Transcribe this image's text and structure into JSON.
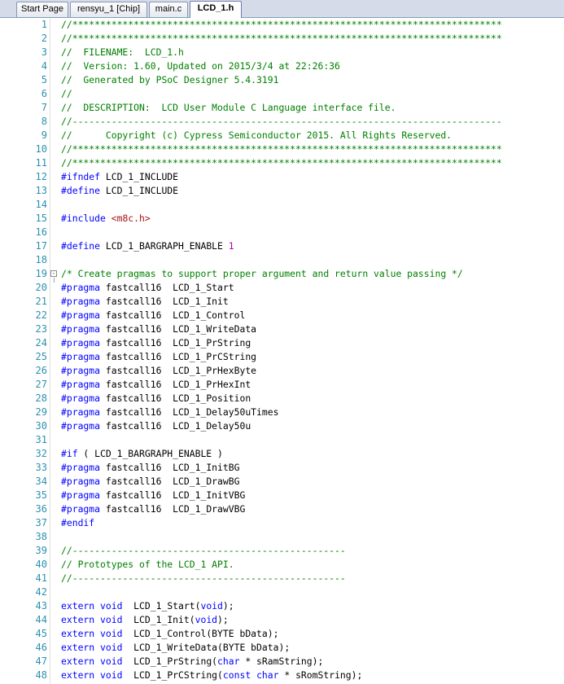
{
  "tabs": [
    {
      "label": "Start Page",
      "active": false
    },
    {
      "label": "rensyu_1 [Chip]",
      "active": false
    },
    {
      "label": "main.c",
      "active": false
    },
    {
      "label": "LCD_1.h",
      "active": true
    }
  ],
  "colors": {
    "comment": "#008000",
    "keyword": "#0000ff",
    "string": "#a31515",
    "number": "#b000b0",
    "line_number": "#2b91af"
  },
  "lines": [
    {
      "n": "1",
      "tokens": [
        {
          "t": "c",
          "v": "//*****************************************************************************"
        }
      ]
    },
    {
      "n": "2",
      "tokens": [
        {
          "t": "c",
          "v": "//*****************************************************************************"
        }
      ]
    },
    {
      "n": "3",
      "tokens": [
        {
          "t": "c",
          "v": "//  FILENAME:  LCD_1.h"
        }
      ]
    },
    {
      "n": "4",
      "tokens": [
        {
          "t": "c",
          "v": "//  Version: 1.60, Updated on 2015/3/4 at 22:26:36"
        }
      ]
    },
    {
      "n": "5",
      "tokens": [
        {
          "t": "c",
          "v": "//  Generated by PSoC Designer 5.4.3191"
        }
      ]
    },
    {
      "n": "6",
      "tokens": [
        {
          "t": "c",
          "v": "//"
        }
      ]
    },
    {
      "n": "7",
      "tokens": [
        {
          "t": "c",
          "v": "//  DESCRIPTION:  LCD User Module C Language interface file."
        }
      ]
    },
    {
      "n": "8",
      "tokens": [
        {
          "t": "c",
          "v": "//-----------------------------------------------------------------------------"
        }
      ]
    },
    {
      "n": "9",
      "tokens": [
        {
          "t": "c",
          "v": "//      Copyright (c) Cypress Semiconductor 2015. All Rights Reserved."
        }
      ]
    },
    {
      "n": "10",
      "tokens": [
        {
          "t": "c",
          "v": "//*****************************************************************************"
        }
      ]
    },
    {
      "n": "11",
      "tokens": [
        {
          "t": "c",
          "v": "//*****************************************************************************"
        }
      ]
    },
    {
      "n": "12",
      "tokens": [
        {
          "t": "k",
          "v": "#ifndef"
        },
        {
          "t": "p",
          "v": " LCD_1_INCLUDE"
        }
      ]
    },
    {
      "n": "13",
      "tokens": [
        {
          "t": "k",
          "v": "#define"
        },
        {
          "t": "p",
          "v": " LCD_1_INCLUDE"
        }
      ]
    },
    {
      "n": "14",
      "tokens": []
    },
    {
      "n": "15",
      "tokens": [
        {
          "t": "k",
          "v": "#include"
        },
        {
          "t": "p",
          "v": " "
        },
        {
          "t": "s",
          "v": "<m8c.h>"
        }
      ]
    },
    {
      "n": "16",
      "tokens": []
    },
    {
      "n": "17",
      "tokens": [
        {
          "t": "k",
          "v": "#define"
        },
        {
          "t": "p",
          "v": " LCD_1_BARGRAPH_ENABLE "
        },
        {
          "t": "n",
          "v": "1"
        }
      ]
    },
    {
      "n": "18",
      "tokens": []
    },
    {
      "n": "19",
      "fold": "-",
      "tokens": [
        {
          "t": "c",
          "v": "/* Create pragmas to support proper argument and return value passing */"
        }
      ]
    },
    {
      "n": "20",
      "tokens": [
        {
          "t": "k",
          "v": "#pragma"
        },
        {
          "t": "p",
          "v": " fastcall16  LCD_1_Start"
        }
      ]
    },
    {
      "n": "21",
      "tokens": [
        {
          "t": "k",
          "v": "#pragma"
        },
        {
          "t": "p",
          "v": " fastcall16  LCD_1_Init"
        }
      ]
    },
    {
      "n": "22",
      "tokens": [
        {
          "t": "k",
          "v": "#pragma"
        },
        {
          "t": "p",
          "v": " fastcall16  LCD_1_Control"
        }
      ]
    },
    {
      "n": "23",
      "tokens": [
        {
          "t": "k",
          "v": "#pragma"
        },
        {
          "t": "p",
          "v": " fastcall16  LCD_1_WriteData"
        }
      ]
    },
    {
      "n": "24",
      "tokens": [
        {
          "t": "k",
          "v": "#pragma"
        },
        {
          "t": "p",
          "v": " fastcall16  LCD_1_PrString"
        }
      ]
    },
    {
      "n": "25",
      "tokens": [
        {
          "t": "k",
          "v": "#pragma"
        },
        {
          "t": "p",
          "v": " fastcall16  LCD_1_PrCString"
        }
      ]
    },
    {
      "n": "26",
      "tokens": [
        {
          "t": "k",
          "v": "#pragma"
        },
        {
          "t": "p",
          "v": " fastcall16  LCD_1_PrHexByte"
        }
      ]
    },
    {
      "n": "27",
      "tokens": [
        {
          "t": "k",
          "v": "#pragma"
        },
        {
          "t": "p",
          "v": " fastcall16  LCD_1_PrHexInt"
        }
      ]
    },
    {
      "n": "28",
      "tokens": [
        {
          "t": "k",
          "v": "#pragma"
        },
        {
          "t": "p",
          "v": " fastcall16  LCD_1_Position"
        }
      ]
    },
    {
      "n": "29",
      "tokens": [
        {
          "t": "k",
          "v": "#pragma"
        },
        {
          "t": "p",
          "v": " fastcall16  LCD_1_Delay50uTimes"
        }
      ]
    },
    {
      "n": "30",
      "tokens": [
        {
          "t": "k",
          "v": "#pragma"
        },
        {
          "t": "p",
          "v": " fastcall16  LCD_1_Delay50u"
        }
      ]
    },
    {
      "n": "31",
      "tokens": []
    },
    {
      "n": "32",
      "tokens": [
        {
          "t": "k",
          "v": "#if"
        },
        {
          "t": "p",
          "v": " ( LCD_1_BARGRAPH_ENABLE )"
        }
      ]
    },
    {
      "n": "33",
      "tokens": [
        {
          "t": "k",
          "v": "#pragma"
        },
        {
          "t": "p",
          "v": " fastcall16  LCD_1_InitBG"
        }
      ]
    },
    {
      "n": "34",
      "tokens": [
        {
          "t": "k",
          "v": "#pragma"
        },
        {
          "t": "p",
          "v": " fastcall16  LCD_1_DrawBG"
        }
      ]
    },
    {
      "n": "35",
      "tokens": [
        {
          "t": "k",
          "v": "#pragma"
        },
        {
          "t": "p",
          "v": " fastcall16  LCD_1_InitVBG"
        }
      ]
    },
    {
      "n": "36",
      "tokens": [
        {
          "t": "k",
          "v": "#pragma"
        },
        {
          "t": "p",
          "v": " fastcall16  LCD_1_DrawVBG"
        }
      ]
    },
    {
      "n": "37",
      "tokens": [
        {
          "t": "k",
          "v": "#endif"
        }
      ]
    },
    {
      "n": "38",
      "tokens": []
    },
    {
      "n": "39",
      "tokens": [
        {
          "t": "c",
          "v": "//-------------------------------------------------"
        }
      ]
    },
    {
      "n": "40",
      "tokens": [
        {
          "t": "c",
          "v": "// Prototypes of the LCD_1 API."
        }
      ]
    },
    {
      "n": "41",
      "tokens": [
        {
          "t": "c",
          "v": "//-------------------------------------------------"
        }
      ]
    },
    {
      "n": "42",
      "tokens": []
    },
    {
      "n": "43",
      "tokens": [
        {
          "t": "k",
          "v": "extern"
        },
        {
          "t": "p",
          "v": " "
        },
        {
          "t": "k",
          "v": "void"
        },
        {
          "t": "p",
          "v": "  LCD_1_Start("
        },
        {
          "t": "k",
          "v": "void"
        },
        {
          "t": "p",
          "v": ");"
        }
      ]
    },
    {
      "n": "44",
      "tokens": [
        {
          "t": "k",
          "v": "extern"
        },
        {
          "t": "p",
          "v": " "
        },
        {
          "t": "k",
          "v": "void"
        },
        {
          "t": "p",
          "v": "  LCD_1_Init("
        },
        {
          "t": "k",
          "v": "void"
        },
        {
          "t": "p",
          "v": ");"
        }
      ]
    },
    {
      "n": "45",
      "tokens": [
        {
          "t": "k",
          "v": "extern"
        },
        {
          "t": "p",
          "v": " "
        },
        {
          "t": "k",
          "v": "void"
        },
        {
          "t": "p",
          "v": "  LCD_1_Control(BYTE bData);"
        }
      ]
    },
    {
      "n": "46",
      "tokens": [
        {
          "t": "k",
          "v": "extern"
        },
        {
          "t": "p",
          "v": " "
        },
        {
          "t": "k",
          "v": "void"
        },
        {
          "t": "p",
          "v": "  LCD_1_WriteData(BYTE bData);"
        }
      ]
    },
    {
      "n": "47",
      "tokens": [
        {
          "t": "k",
          "v": "extern"
        },
        {
          "t": "p",
          "v": " "
        },
        {
          "t": "k",
          "v": "void"
        },
        {
          "t": "p",
          "v": "  LCD_1_PrString("
        },
        {
          "t": "k",
          "v": "char"
        },
        {
          "t": "p",
          "v": " * sRamString);"
        }
      ]
    },
    {
      "n": "48",
      "tokens": [
        {
          "t": "k",
          "v": "extern"
        },
        {
          "t": "p",
          "v": " "
        },
        {
          "t": "k",
          "v": "void"
        },
        {
          "t": "p",
          "v": "  LCD_1_PrCString("
        },
        {
          "t": "k",
          "v": "const"
        },
        {
          "t": "p",
          "v": " "
        },
        {
          "t": "k",
          "v": "char"
        },
        {
          "t": "p",
          "v": " * sRomString);"
        }
      ]
    }
  ]
}
